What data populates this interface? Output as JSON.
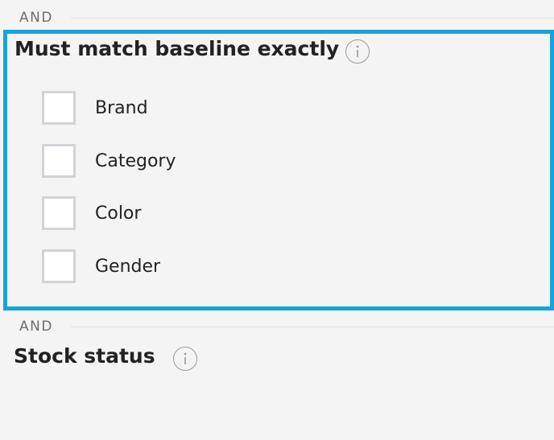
{
  "filters": {
    "connector_top": "AND",
    "connector_bottom": "AND",
    "baseline_group": {
      "title": "Must match baseline exactly",
      "info_icon": "info-icon",
      "options": [
        {
          "label": "Brand",
          "checked": false
        },
        {
          "label": "Category",
          "checked": false
        },
        {
          "label": "Color",
          "checked": false
        },
        {
          "label": "Gender",
          "checked": false
        }
      ]
    },
    "stock_group": {
      "title": "Stock status",
      "info_icon": "info-icon"
    }
  },
  "colors": {
    "highlight_border": "#19a4d6",
    "background": "#f4f4f4",
    "checkbox_border": "#d2d2d8",
    "connector_text": "#6e6e6e"
  }
}
